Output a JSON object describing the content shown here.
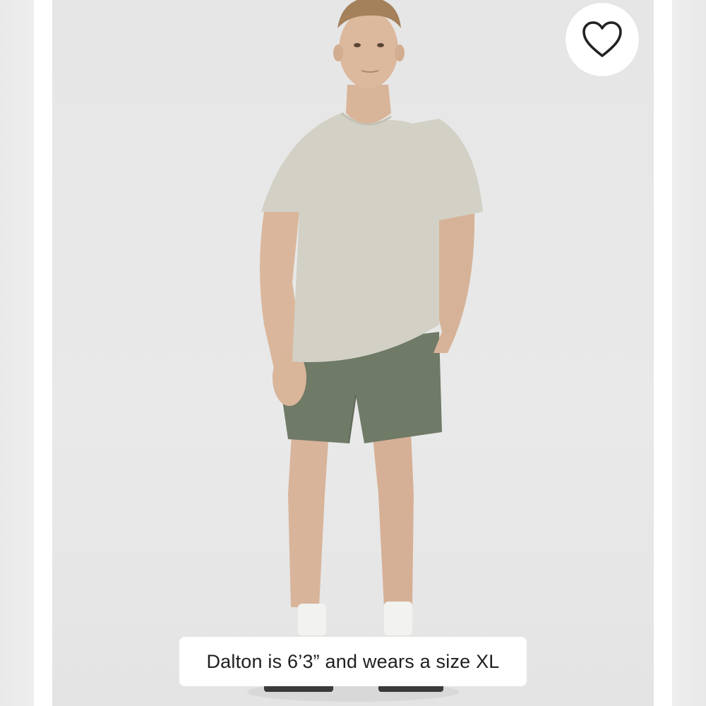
{
  "product": {
    "image_alt": "Model wearing grey t-shirt and green shorts",
    "model_caption": "Dalton is 6’3” and wears a size XL"
  },
  "wishlist": {
    "icon": "heart-outline-icon",
    "state": "not-favorited"
  },
  "colors": {
    "tshirt": "#d3d1c6",
    "shorts": "#6f7a67",
    "background": "#e7e7e7",
    "caption_bg": "#ffffff"
  }
}
